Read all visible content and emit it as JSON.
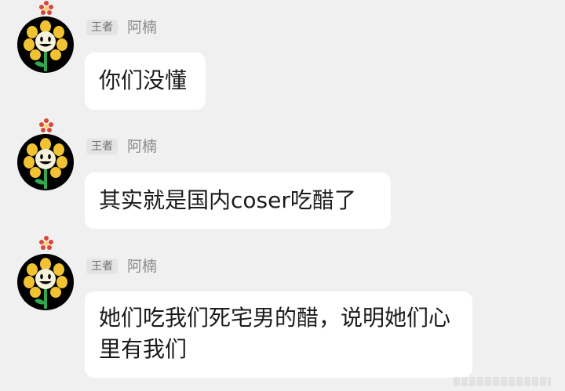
{
  "messages": [
    {
      "badge": "王者",
      "sender": "阿楠",
      "avatar_icon": "smiling-flower-icon",
      "text": "你们没懂"
    },
    {
      "badge": "王者",
      "sender": "阿楠",
      "avatar_icon": "smiling-flower-icon",
      "text": "其实就是国内coser吃醋了"
    },
    {
      "badge": "王者",
      "sender": "阿楠",
      "avatar_icon": "smiling-flower-icon",
      "text": "她们吃我们死宅男的醋，说明她们心里有我们"
    }
  ],
  "colors": {
    "background": "#f0f0f0",
    "bubble": "#ffffff",
    "badge_bg": "#e4e4e4",
    "petal": "#f1c232",
    "stem": "#2fa84f"
  }
}
